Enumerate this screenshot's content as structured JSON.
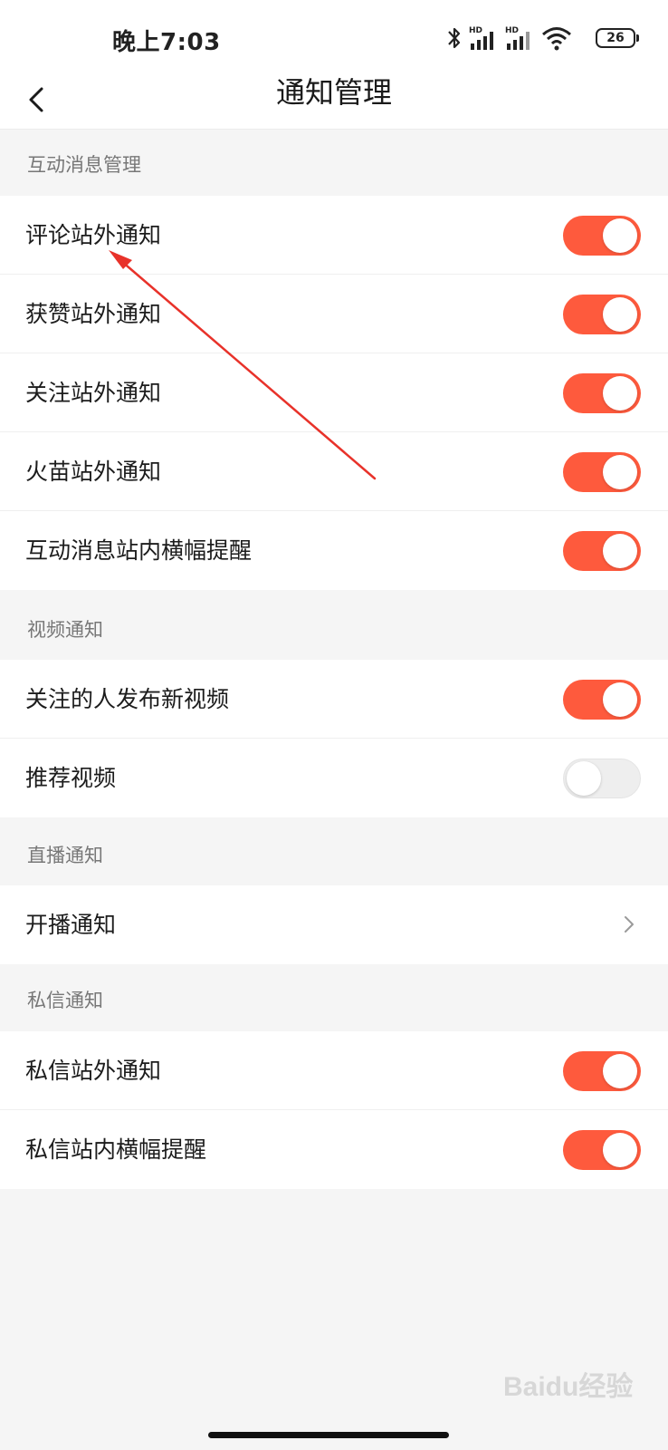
{
  "status_bar": {
    "time": "晚上7:03",
    "battery": "26",
    "hd1": "HD",
    "hd2": "HD"
  },
  "header": {
    "title": "通知管理"
  },
  "sections": [
    {
      "label": "互动消息管理"
    },
    {
      "label": "视频通知"
    },
    {
      "label": "直播通知"
    },
    {
      "label": "私信通知"
    }
  ],
  "rows": [
    {
      "label": "评论站外通知",
      "on": true
    },
    {
      "label": "获赞站外通知",
      "on": true
    },
    {
      "label": "关注站外通知",
      "on": true
    },
    {
      "label": "火苗站外通知",
      "on": true
    },
    {
      "label": "互动消息站内横幅提醒",
      "on": true
    },
    {
      "label": "关注的人发布新视频",
      "on": true
    },
    {
      "label": "推荐视频",
      "on": false
    },
    {
      "label": "开播通知"
    },
    {
      "label": "私信站外通知",
      "on": true
    },
    {
      "label": "私信站内横幅提醒",
      "on": true
    }
  ],
  "watermark": "Baidu经验",
  "colors": {
    "accent": "#fe5a3d",
    "arrow": "#e8322a"
  }
}
